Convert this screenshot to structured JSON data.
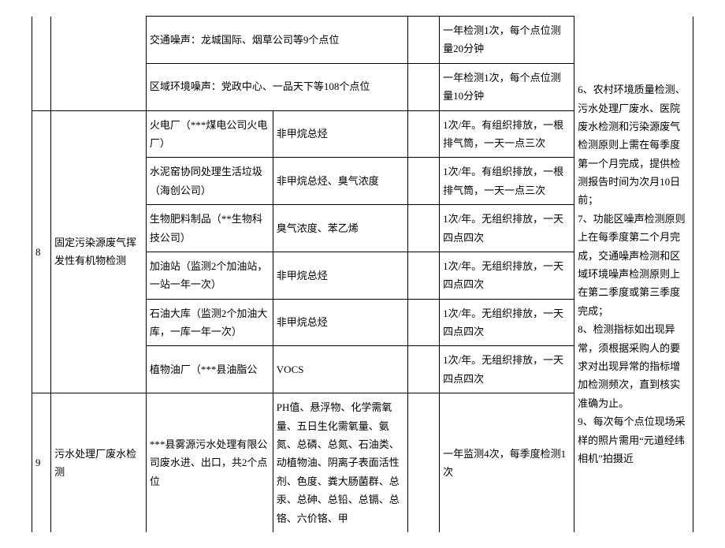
{
  "rows": [
    {
      "source": "交通噪声：龙城国际、烟草公司等9个点位",
      "freq": "一年检测1次，每个点位测量20分钟"
    },
    {
      "source": "区域环境噪声：党政中心、一品天下等108个点位",
      "freq": "一年检测1次，每个点位测量10分钟"
    },
    {
      "idx": "8",
      "category": "固定污染源废气挥发性有机物检测",
      "source": "火电厂（***煤电公司火电厂）",
      "item": "非甲烷总烃",
      "freq": "1次/年。有组织排放，一根排气筒，一天一点三次"
    },
    {
      "source": "水泥窑协同处理生活垃圾（海创公司）",
      "item": "非甲烷总烃、臭气浓度",
      "freq": "1次/年。有组织排放，一根排气筒，一天一点三次"
    },
    {
      "source": "生物肥料制品（**生物科技公司）",
      "item": "臭气浓度、苯乙烯",
      "freq": "1次/年。无组织排放，一天四点四次"
    },
    {
      "source": "加油站（监测2个加油站，一站一年一次）",
      "item": "非甲烷总烃",
      "freq": "1次/年。无组织排放，一天四点四次"
    },
    {
      "source": "石油大库（监测2个加油大库，一库一年一次）",
      "item": "非甲烷总烃",
      "freq": "1次/年。无组织排放，一天四点四次"
    },
    {
      "source": "植物油厂（***县油脂公",
      "item": "VOCS",
      "freq": "1次/年。无组织排放，一天四点四次"
    },
    {
      "idx": "9",
      "category": "污水处理厂废水检测",
      "source": "***县雾源污水处理有限公司废水进、出口，共2个点位",
      "item": "PH值、悬浮物、化学需氧量、五日生化需氧量、氨氮、总磷、总氮、石油类、动植物油、阴离子表面活性剂、色度、粪大肠菌群、总汞、总砷、总铅、总镉、总铬、六价铬、甲",
      "freq": "一年监测4次，每季度检测1次"
    }
  ],
  "note": "6、农村环境质量检测、污水处理厂废水、医院废水检测和污染源废气检测原则上需在每季度第一个月完成，提供检测报告时间为次月10日前；\n7、功能区噪声检测原则上在每季度第二个月完成，交通噪声检测和区域环境噪声检测原则上在第二季度或第三季度完成；\n8、检测指标如出现异常，须根据采购人的要求对出现异常的指标增加检测频次，直到核实准确为止。\n9、每次每个点位现场采样的照片需用“元道经纬相机”拍摄近"
}
